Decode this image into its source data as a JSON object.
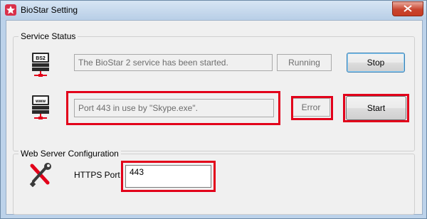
{
  "window": {
    "title": "BioStar Setting"
  },
  "service_status": {
    "group_label": "Service Status",
    "bs2": {
      "icon_text": "BS2",
      "message": "The BioStar 2 service has been started.",
      "status": "Running",
      "button_label": "Stop"
    },
    "web": {
      "icon_text": "www",
      "message": "Port 443 in use by \"Skype.exe\".",
      "status": "Error",
      "button_label": "Start"
    }
  },
  "web_server": {
    "group_label": "Web Server Configuration",
    "https_label": "HTTPS Port",
    "https_port": "443"
  },
  "colors": {
    "highlight": "#e2001a",
    "title_bar": "#bcd2ea"
  }
}
